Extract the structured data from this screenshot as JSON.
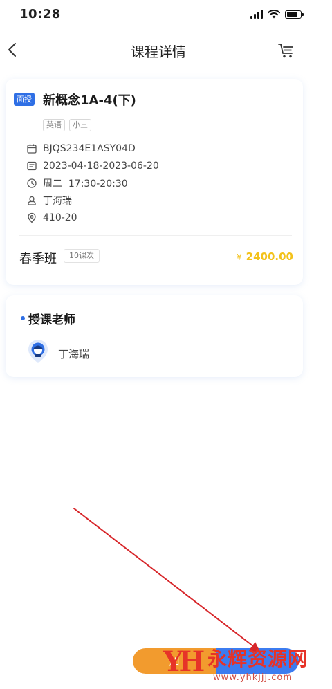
{
  "status_bar": {
    "time": "10:28"
  },
  "nav": {
    "title": "课程详情"
  },
  "course": {
    "mode_tag": "面授",
    "title": "新概念1A-4(下)",
    "subject_tags": [
      "英语",
      "小三"
    ],
    "code": "BJQS234E1ASY04D",
    "date_range": "2023-04-18-2023-06-20",
    "schedule": "周二  17:30-20:30",
    "teacher": "丁海瑞",
    "room": "410-20",
    "class_name": "春季班",
    "lesson_count": "10课次",
    "price_currency": "¥",
    "price": "2400.00"
  },
  "teacher_section": {
    "title": "授课老师",
    "teacher_name": "丁海瑞"
  },
  "bottom_bar": {
    "add_label": "加",
    "buy_label": ""
  },
  "watermark": {
    "logo": "YH",
    "text": "永辉资源网",
    "url": "www.yhkjjj.com"
  },
  "colors": {
    "accent_blue": "#2f6fe5",
    "price_yellow": "#f3c21b",
    "button_orange": "#f29b2e",
    "button_blue": "#3c7cf0",
    "annotation_red": "#d7262a",
    "watermark_red": "#e63328"
  },
  "icons": {
    "back": "chevron-left-icon",
    "cart": "cart-icon",
    "code": "calendar-icon",
    "date": "date-range-icon",
    "time": "clock-icon",
    "teacher": "person-icon",
    "location": "location-pin-icon"
  }
}
